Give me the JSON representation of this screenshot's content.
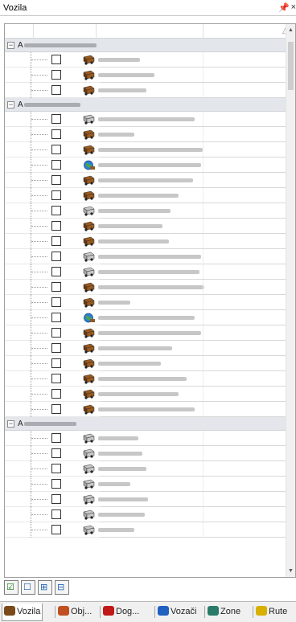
{
  "window": {
    "title": "Vozila",
    "pin_glyph": "―",
    "close_glyph": "×"
  },
  "header": {
    "sort_glyph": "△"
  },
  "groups": [
    {
      "label": "A",
      "blur_width": 90,
      "rows": [
        {
          "icon": "truck-brown-icon",
          "blur": 52
        },
        {
          "icon": "truck-brown-icon",
          "blur": 70
        },
        {
          "icon": "truck-brown-icon",
          "blur": 60
        }
      ]
    },
    {
      "label": "A",
      "blur_width": 70,
      "rows": [
        {
          "icon": "truck-gray-icon",
          "blur": 120
        },
        {
          "icon": "truck-brown-icon",
          "blur": 45
        },
        {
          "icon": "truck-brown-icon",
          "blur": 130
        },
        {
          "icon": "globe-truck-icon",
          "blur": 128
        },
        {
          "icon": "truck-brown-icon",
          "blur": 118
        },
        {
          "icon": "truck-brown-icon",
          "blur": 100
        },
        {
          "icon": "truck-gray-icon",
          "blur": 90
        },
        {
          "icon": "truck-brown-icon",
          "blur": 80
        },
        {
          "icon": "truck-brown-icon",
          "blur": 88
        },
        {
          "icon": "truck-gray-icon",
          "blur": 128
        },
        {
          "icon": "truck-gray-icon",
          "blur": 126
        },
        {
          "icon": "truck-brown-icon",
          "blur": 132
        },
        {
          "icon": "truck-brown-icon",
          "blur": 40
        },
        {
          "icon": "globe-truck-icon",
          "blur": 120
        },
        {
          "icon": "truck-brown-icon",
          "blur": 128
        },
        {
          "icon": "truck-brown-icon",
          "blur": 92
        },
        {
          "icon": "truck-brown-icon",
          "blur": 78
        },
        {
          "icon": "truck-brown-icon",
          "blur": 110
        },
        {
          "icon": "truck-brown-icon",
          "blur": 100
        },
        {
          "icon": "truck-brown-icon",
          "blur": 120
        }
      ]
    },
    {
      "label": "A",
      "blur_width": 65,
      "rows": [
        {
          "icon": "truck-gray-icon",
          "blur": 50
        },
        {
          "icon": "truck-gray-icon",
          "blur": 55
        },
        {
          "icon": "truck-gray-icon",
          "blur": 60
        },
        {
          "icon": "truck-gray-icon",
          "blur": 40
        },
        {
          "icon": "truck-gray-icon",
          "blur": 62
        },
        {
          "icon": "truck-gray-icon",
          "blur": 58
        },
        {
          "icon": "truck-gray-icon",
          "blur": 45
        }
      ]
    }
  ],
  "toolbar": [
    {
      "name": "check-all-icon",
      "glyph": "☑",
      "color": "#1a7a1a"
    },
    {
      "name": "uncheck-all-icon",
      "glyph": "☐",
      "color": "#1a5fb4"
    },
    {
      "name": "expand-all-icon",
      "glyph": "⊞",
      "color": "#1a5fb4"
    },
    {
      "name": "collapse-all-icon",
      "glyph": "⊟",
      "color": "#1a5fb4"
    }
  ],
  "tabs": [
    {
      "label": "Vozila",
      "icon": "truck-icon",
      "color": "#7a4a1a",
      "active": true
    },
    {
      "label": "Obj...",
      "icon": "objects-icon",
      "color": "#c05020",
      "active": false
    },
    {
      "label": "Dog...",
      "icon": "events-icon",
      "color": "#c01818",
      "active": false
    },
    {
      "label": "Vozači",
      "icon": "drivers-icon",
      "color": "#2060c0",
      "active": false
    },
    {
      "label": "Zone",
      "icon": "zones-icon",
      "color": "#2a7a6a",
      "active": false
    },
    {
      "label": "Rute",
      "icon": "routes-icon",
      "color": "#d8b000",
      "active": false
    }
  ]
}
